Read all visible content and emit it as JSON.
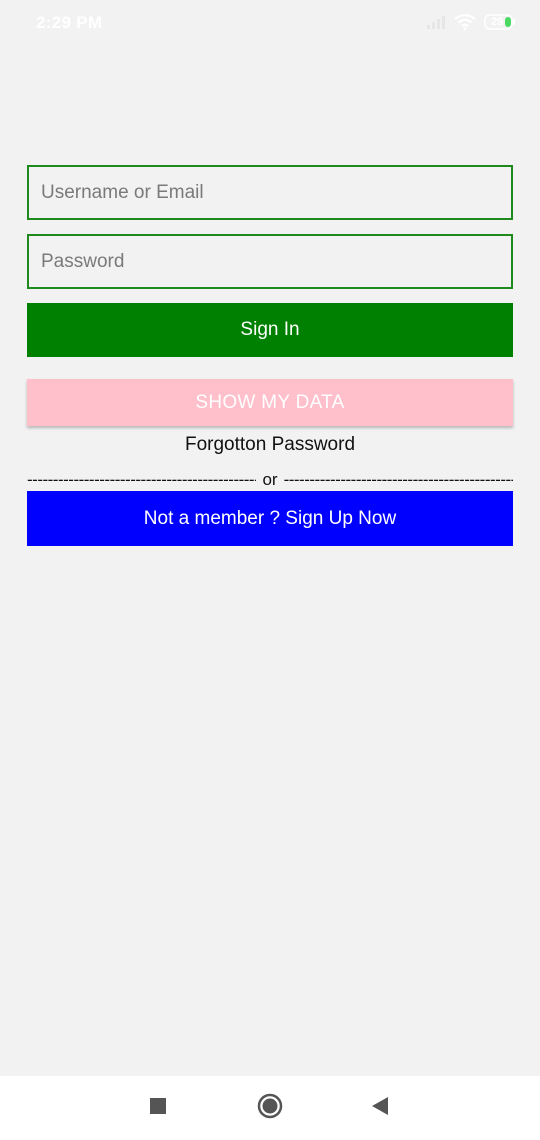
{
  "status_bar": {
    "time": "2:29 PM",
    "battery_level": "29",
    "icons": [
      "signal-icon",
      "wifi-icon",
      "battery-icon"
    ]
  },
  "login_form": {
    "username_placeholder": "Username or Email",
    "username_value": "",
    "password_placeholder": "Password",
    "password_value": "",
    "sign_in_label": "Sign In",
    "show_data_label": "SHOW MY DATA",
    "forgot_password_label": "Forgotton Password",
    "divider_or": "or",
    "sign_up_label": "Not a member ? Sign Up Now"
  },
  "navigation_bar": {
    "icons": [
      "recents-square-icon",
      "home-circle-icon",
      "back-triangle-icon"
    ]
  },
  "colors": {
    "background": "#f2f2f2",
    "field_border": "#1e8a1e",
    "sign_in": "#008000",
    "show_data": "#ffc0cb",
    "sign_up": "#0000ff",
    "battery_fill": "#4cd964"
  }
}
